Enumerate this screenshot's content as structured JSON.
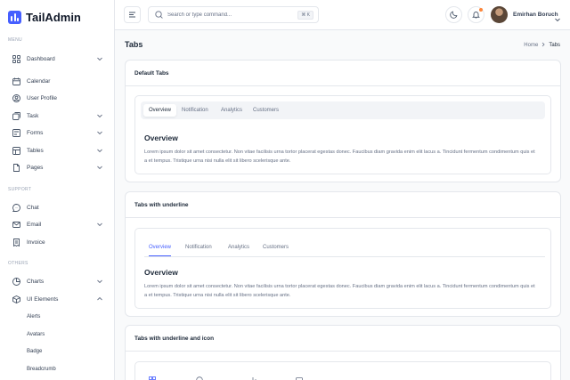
{
  "brand": {
    "name": "TailAdmin",
    "color": "#465fff"
  },
  "sidebar": {
    "groups": {
      "menu": "MENU",
      "support": "SUPPORT",
      "others": "OTHERS"
    },
    "items": [
      {
        "label": "Dashboard",
        "icon": "grid-icon"
      },
      {
        "label": "Calendar",
        "icon": "calendar-icon"
      },
      {
        "label": "User Profile",
        "icon": "user-circle-icon"
      },
      {
        "label": "Task",
        "icon": "task-icon"
      },
      {
        "label": "Forms",
        "icon": "forms-icon"
      },
      {
        "label": "Tables",
        "icon": "table-icon"
      },
      {
        "label": "Pages",
        "icon": "page-icon"
      },
      {
        "label": "Chat",
        "icon": "chat-icon"
      },
      {
        "label": "Email",
        "icon": "mail-icon"
      },
      {
        "label": "Invoice",
        "icon": "invoice-icon"
      },
      {
        "label": "Charts",
        "icon": "pie-chart-icon"
      },
      {
        "label": "UI Elements",
        "icon": "box-icon"
      }
    ],
    "ui_sub_items": [
      "Alerts",
      "Avatars",
      "Badge",
      "Breadcrumb"
    ]
  },
  "header": {
    "search_placeholder": "Search or type command...",
    "search_shortcut": "⌘ K",
    "user_name": "Emirhan Boruch",
    "notification_dot_color": "#fd853a"
  },
  "page": {
    "title": "Tabs",
    "breadcrumb": {
      "home": "Home",
      "current": "Tabs"
    }
  },
  "cards": {
    "default_tabs": {
      "title": "Default Tabs",
      "tabs": [
        "Overview",
        "Notification",
        "Analytics",
        "Customers"
      ],
      "active_tab": "Overview",
      "panel_heading": "Overview",
      "panel_text": "Lorem ipsum dolor sit amet consectetur. Non vitae facilisis urna tortor placerat egestas donec. Faucibus diam gravida enim elit lacus a. Tincidunt fermentum condimentum quis et a et tempus. Tristique urna nisi nulla elit sit libero scelerisque ante."
    },
    "underline_tabs": {
      "title": "Tabs with underline",
      "tabs": [
        "Overview",
        "Notification",
        "Analytics",
        "Customers"
      ],
      "active_tab": "Overview",
      "panel_heading": "Overview",
      "panel_text": "Lorem ipsum dolor sit amet consectetur. Non vitae facilisis urna tortor placerat egestas donec. Faucibus diam gravida enim elit lacus a. Tincidunt fermentum condimentum quis et a et tempus. Tristique urna nisi nulla elit sit libero scelerisque ante."
    },
    "icon_tabs": {
      "title": "Tabs with underline and icon"
    }
  }
}
